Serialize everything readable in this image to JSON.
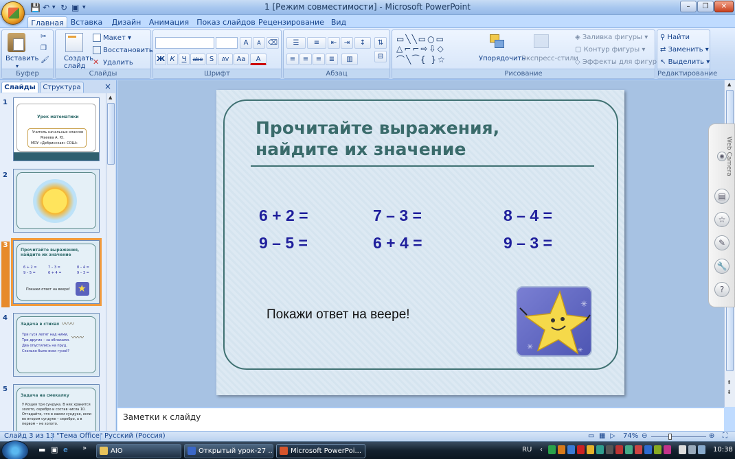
{
  "window": {
    "title": "1 [Режим совместимости] - Microsoft PowerPoint",
    "min": "–",
    "max": "❐",
    "close": "✕"
  },
  "tabs": [
    "Главная",
    "Вставка",
    "Дизайн",
    "Анимация",
    "Показ слайдов",
    "Рецензирование",
    "Вид"
  ],
  "active_tab": "Главная",
  "ribbon": {
    "clipboard": {
      "label": "Буфер обмена",
      "paste": "Вставить"
    },
    "slides": {
      "label": "Слайды",
      "new_slide": "Создать слайд",
      "layout": "Макет",
      "reset": "Восстановить",
      "delete": "Удалить"
    },
    "font": {
      "label": "Шрифт",
      "b": "Ж",
      "i": "К",
      "u": "Ч",
      "s": "abe",
      "shadow": "S",
      "spacing": "AV",
      "case": "Aa",
      "grow": "A",
      "shrink": "A",
      "color": "A"
    },
    "paragraph": {
      "label": "Абзац"
    },
    "drawing": {
      "label": "Рисование",
      "arrange": "Упорядочить",
      "quick_styles": "Экспресс-стили",
      "fill": "Заливка фигуры",
      "outline": "Контур фигуры",
      "effects": "Эффекты для фигур"
    },
    "editing": {
      "label": "Редактирование",
      "find": "Найти",
      "replace": "Заменить",
      "select": "Выделить"
    }
  },
  "left_pane": {
    "tabs": [
      "Слайды",
      "Структура"
    ],
    "close": "×",
    "thumbnails": [
      {
        "number": "1",
        "title": "Урок математики",
        "lines": [
          "Учитель начальных классов",
          "Маеева А. Ю.",
          "МОУ «Дебринская» СОШ»"
        ]
      },
      {
        "number": "2",
        "title": ""
      },
      {
        "number": "3",
        "title": "Прочитайте выражения, найдите их значение",
        "lines": [
          "6 + 2 =",
          "7 – 3 =",
          "8 – 4 =",
          "9 – 5 =",
          "6 + 4 =",
          "9 – 3 =",
          "Покажи ответ на веере!"
        ]
      },
      {
        "number": "4",
        "title": "Задача в стихах",
        "lines": [
          "Три гуся летят над ними,",
          "Три других – за облаками.",
          "Два опустились на пруд,",
          "Сколько было всех гусей?"
        ]
      },
      {
        "number": "5",
        "title": "Задача на смекалку",
        "lines": [
          "У Кощея три сундука. В них хранится",
          "золото, серебро и состав числа 10.",
          "Отгадайте, что в каком сундуке, если",
          "во втором сундуке – серебро, а в",
          "первом – не золото."
        ]
      }
    ]
  },
  "slide": {
    "title": "Прочитайте выражения, найдите их значение",
    "expressions": [
      "6 + 2 =",
      "7 – 3 =",
      "8 – 4 =",
      "9 – 5 =",
      "6 + 4 =",
      "9 – 3 ="
    ],
    "caption": "Покажи ответ на веере!"
  },
  "webcam": {
    "label": "Web Camera"
  },
  "notes": {
    "placeholder": "Заметки к слайду"
  },
  "status": {
    "slide": "Слайд 3 из 13",
    "theme": "\"Тема Office\"",
    "language": "Русский (Россия)",
    "zoom": "74%"
  },
  "taskbar": {
    "items": [
      "AIO",
      "Открытый урок-27 ...",
      "Microsoft PowerPoi..."
    ],
    "lang": "RU",
    "clock": "10:38"
  }
}
